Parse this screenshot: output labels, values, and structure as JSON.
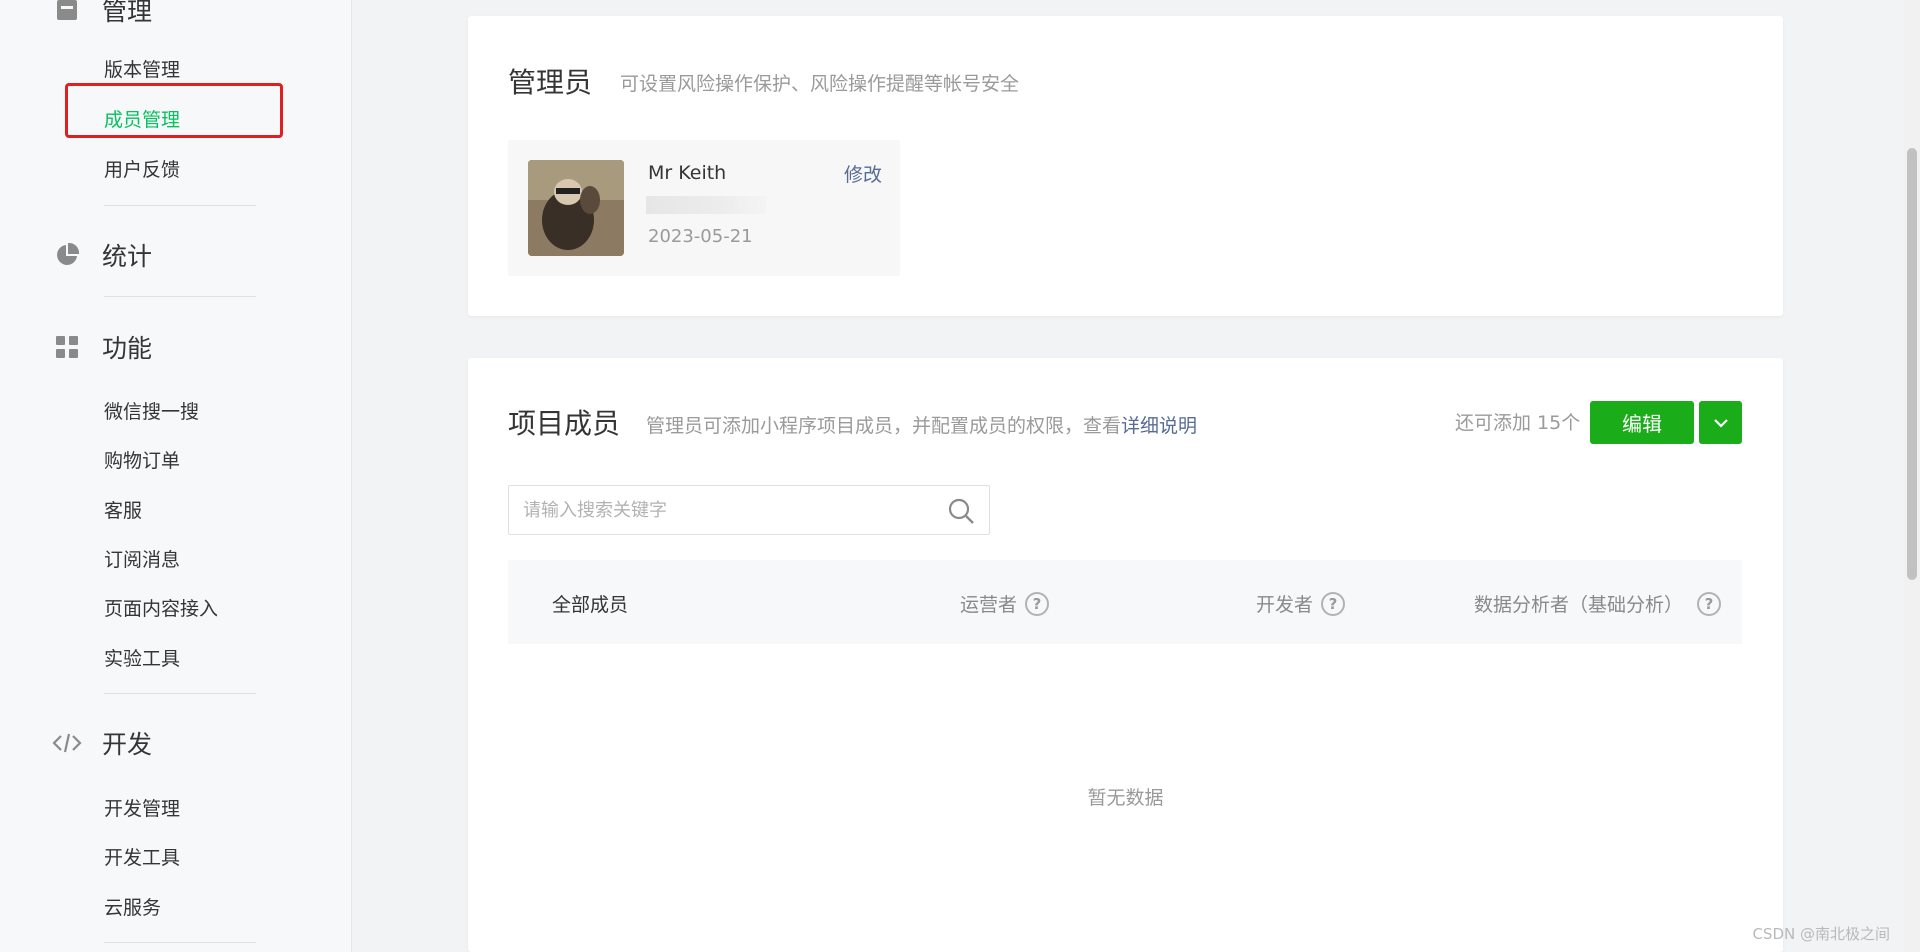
{
  "sidebar": {
    "sections": [
      {
        "title": "管理",
        "icon": "manage-icon",
        "items": [
          "版本管理",
          "成员管理",
          "用户反馈"
        ],
        "active": "成员管理"
      },
      {
        "title": "统计",
        "icon": "pie-chart-icon",
        "items": []
      },
      {
        "title": "功能",
        "icon": "grid-icon",
        "items": [
          "微信搜一搜",
          "购物订单",
          "客服",
          "订阅消息",
          "页面内容接入",
          "实验工具"
        ]
      },
      {
        "title": "开发",
        "icon": "code-icon",
        "items": [
          "开发管理",
          "开发工具",
          "云服务"
        ]
      }
    ]
  },
  "admin": {
    "title": "管理员",
    "desc": "可设置风险操作保护、风险操作提醒等帐号安全",
    "name": "Mr Keith",
    "date": "2023-05-21",
    "edit_label": "修改"
  },
  "members": {
    "title": "项目成员",
    "desc": "管理员可添加小程序项目成员，并配置成员的权限，查看",
    "desc_link": "详细说明",
    "quota": "还可添加 15个",
    "edit_button": "编辑",
    "search_placeholder": "请输入搜索关键字",
    "columns": [
      "全部成员",
      "运营者",
      "开发者",
      "数据分析者（基础分析）"
    ],
    "empty_text": "暂无数据"
  },
  "watermark": "CSDN @南北极之间",
  "colors": {
    "accent": "#1aad19",
    "active_nav": "#07c160",
    "link": "#576b95",
    "highlight": "#e02020"
  }
}
